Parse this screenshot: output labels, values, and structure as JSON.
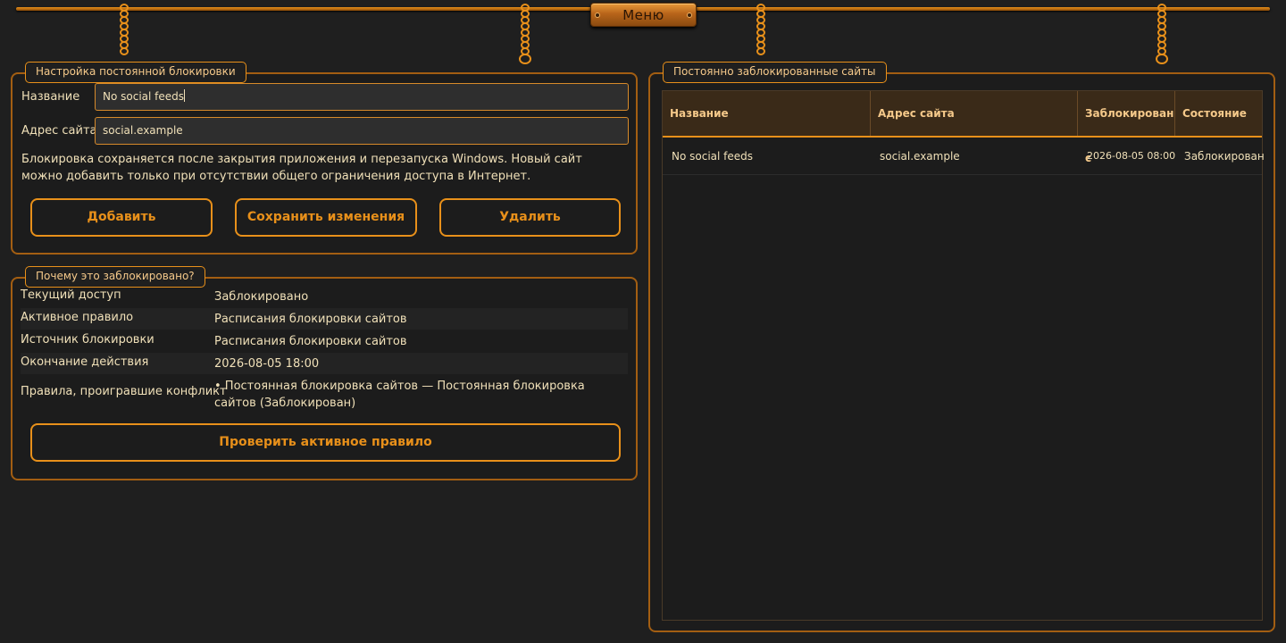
{
  "menu": {
    "label": "Меню"
  },
  "settings": {
    "title": "Настройка постоянной блокировки",
    "name_label": "Название",
    "name_value": "No social feeds",
    "site_label": "Адрес сайта",
    "site_value": "social.example",
    "note": "Блокировка сохраняется после закрытия приложения и перезапуска Windows. Новый сайт можно добавить только при отсутствии общего ограничения доступа в Интернет.",
    "add_label": "Добавить",
    "save_label": "Сохранить изменения",
    "delete_label": "Удалить"
  },
  "why": {
    "title": "Почему это заблокировано?",
    "rows": [
      {
        "key": "Текущий доступ",
        "value": "Заблокировано"
      },
      {
        "key": "Активное правило",
        "value": "Расписания блокировки сайтов"
      },
      {
        "key": "Источник блокировки",
        "value": "Расписания блокировки сайтов"
      },
      {
        "key": "Окончание действия",
        "value": "2026-08-05 18:00"
      },
      {
        "key": "Правила, проигравшие конфликт",
        "value": "• Постоянная блокировка сайтов — Постоянная блокировка сайтов (Заблокирован)"
      }
    ],
    "check_label": "Проверить активное правило"
  },
  "blocked": {
    "title": "Постоянно заблокированные сайты",
    "columns": [
      "Название",
      "Адрес сайта",
      "Заблокирован с",
      "Состояние"
    ],
    "rows": [
      {
        "name": "No social feeds",
        "site": "social.example",
        "since": "2026-08-05 08:00",
        "state": "Заблокирован"
      }
    ]
  },
  "colors": {
    "accent": "#e8901a",
    "background": "#1f1f1f",
    "text": "#f0e0b8"
  }
}
